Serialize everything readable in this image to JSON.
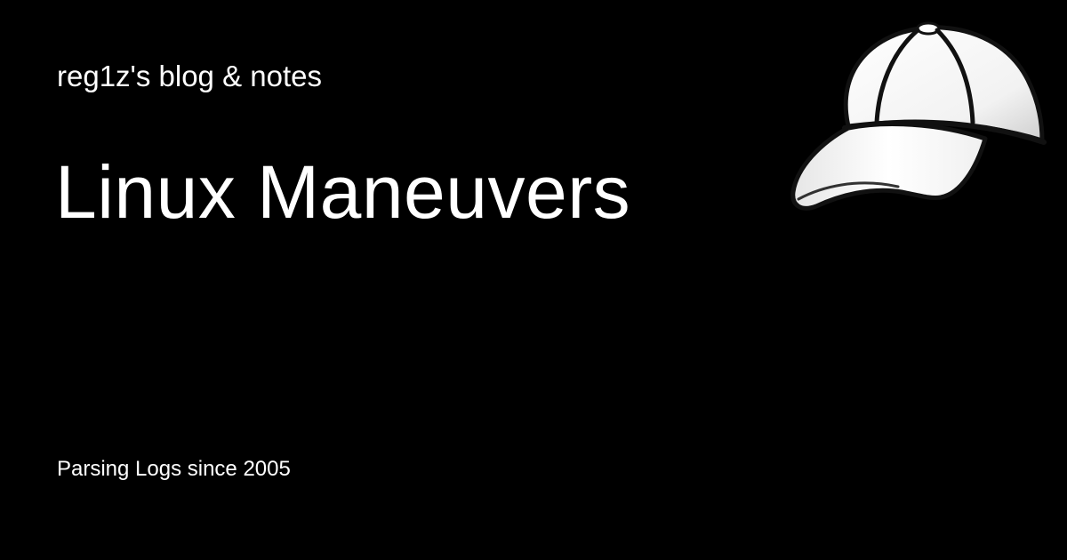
{
  "site": {
    "name": "reg1z's blog & notes",
    "tagline": "Parsing Logs since 2005"
  },
  "post": {
    "title": "Linux Maneuvers"
  },
  "logo": {
    "icon": "baseball-cap-icon"
  },
  "colors": {
    "background": "#000000",
    "text": "#ffffff"
  }
}
